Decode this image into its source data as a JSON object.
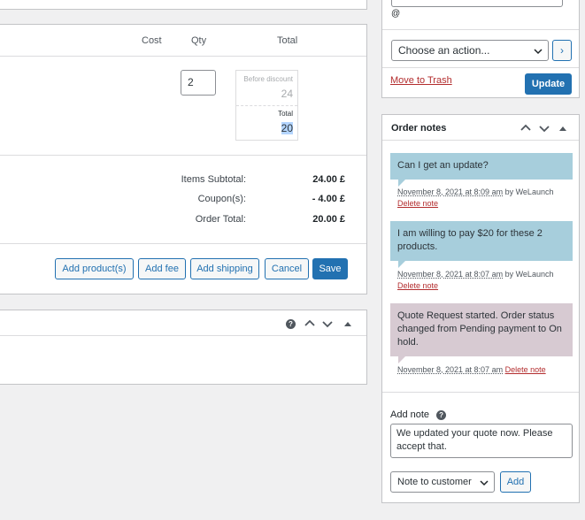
{
  "items": {
    "columns": {
      "cost": "Cost",
      "qty": "Qty",
      "total": "Total"
    },
    "quantity": "2",
    "before_discount_label": "Before discount",
    "before_discount_value": "24",
    "total_label": "Total",
    "total_value": "20"
  },
  "summary": [
    {
      "label": "Items Subtotal:",
      "value": "24.00 £"
    },
    {
      "label": "Coupon(s):",
      "value": "- 4.00 £"
    },
    {
      "label": "Order Total:",
      "value": "20.00 £"
    }
  ],
  "buttons": {
    "add_products": "Add product(s)",
    "add_fee": "Add fee",
    "add_shipping": "Add shipping",
    "cancel": "Cancel",
    "save": "Save"
  },
  "actions": {
    "at_sign": "@",
    "select_value": "Choose an action...",
    "go_label": "›",
    "trash_link": "Move to Trash",
    "update_button": "Update"
  },
  "notes": {
    "title": "Order notes",
    "list": [
      {
        "text": "Can I get an update?",
        "date": "November 8, 2021 at 8:09 am",
        "by": "by WeLaunch",
        "delete": "Delete note"
      },
      {
        "text": "I am willing to pay $20 for these 2 products.",
        "date": "November 8, 2021 at 8:07 am",
        "by": "by WeLaunch",
        "delete": "Delete note"
      },
      {
        "text": "Quote Request started. Order status changed from Pending payment to On hold.",
        "date": "November 8, 2021 at 8:07 am",
        "by": "",
        "delete": "Delete note"
      }
    ],
    "add_note_label": "Add note",
    "help_glyph": "?",
    "textarea_value": "We updated your quote now. Please accept that.",
    "note_type_value": "Note to customer",
    "add_button": "Add"
  },
  "colors": {
    "primary": "#2271b1",
    "danger": "#b32d2e",
    "customer_note": "#a7cedc",
    "system_note": "#d7cad2"
  }
}
